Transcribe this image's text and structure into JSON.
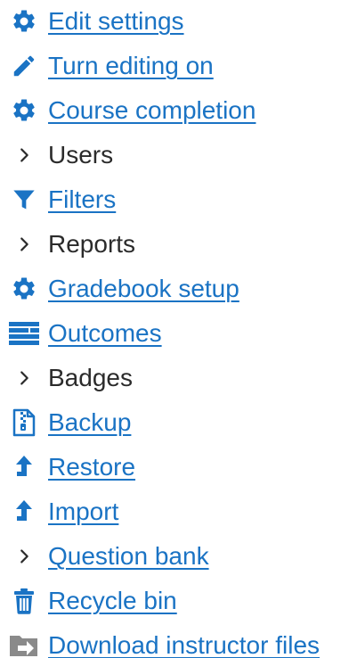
{
  "menu": {
    "items": [
      {
        "label": "Edit settings",
        "icon": "gear-icon"
      },
      {
        "label": "Turn editing on",
        "icon": "pencil-icon"
      },
      {
        "label": "Course completion",
        "icon": "gear-icon"
      },
      {
        "label": "Users",
        "icon": "chevron-right-icon"
      },
      {
        "label": "Filters",
        "icon": "filter-icon"
      },
      {
        "label": "Reports",
        "icon": "chevron-right-icon"
      },
      {
        "label": "Gradebook setup",
        "icon": "gear-icon"
      },
      {
        "label": "Outcomes",
        "icon": "list-icon"
      },
      {
        "label": "Badges",
        "icon": "chevron-right-icon"
      },
      {
        "label": "Backup",
        "icon": "archive-file-icon"
      },
      {
        "label": "Restore",
        "icon": "level-up-arrow-icon"
      },
      {
        "label": "Import",
        "icon": "level-up-arrow-icon"
      },
      {
        "label": "Question bank",
        "icon": "chevron-right-icon"
      },
      {
        "label": "Recycle bin",
        "icon": "trash-icon"
      },
      {
        "label": "Download instructor files",
        "icon": "folder-export-icon"
      }
    ]
  },
  "colors": {
    "link": "#1a73c4",
    "text": "#2b2b2b",
    "icon_gray": "#8a8a8a"
  }
}
